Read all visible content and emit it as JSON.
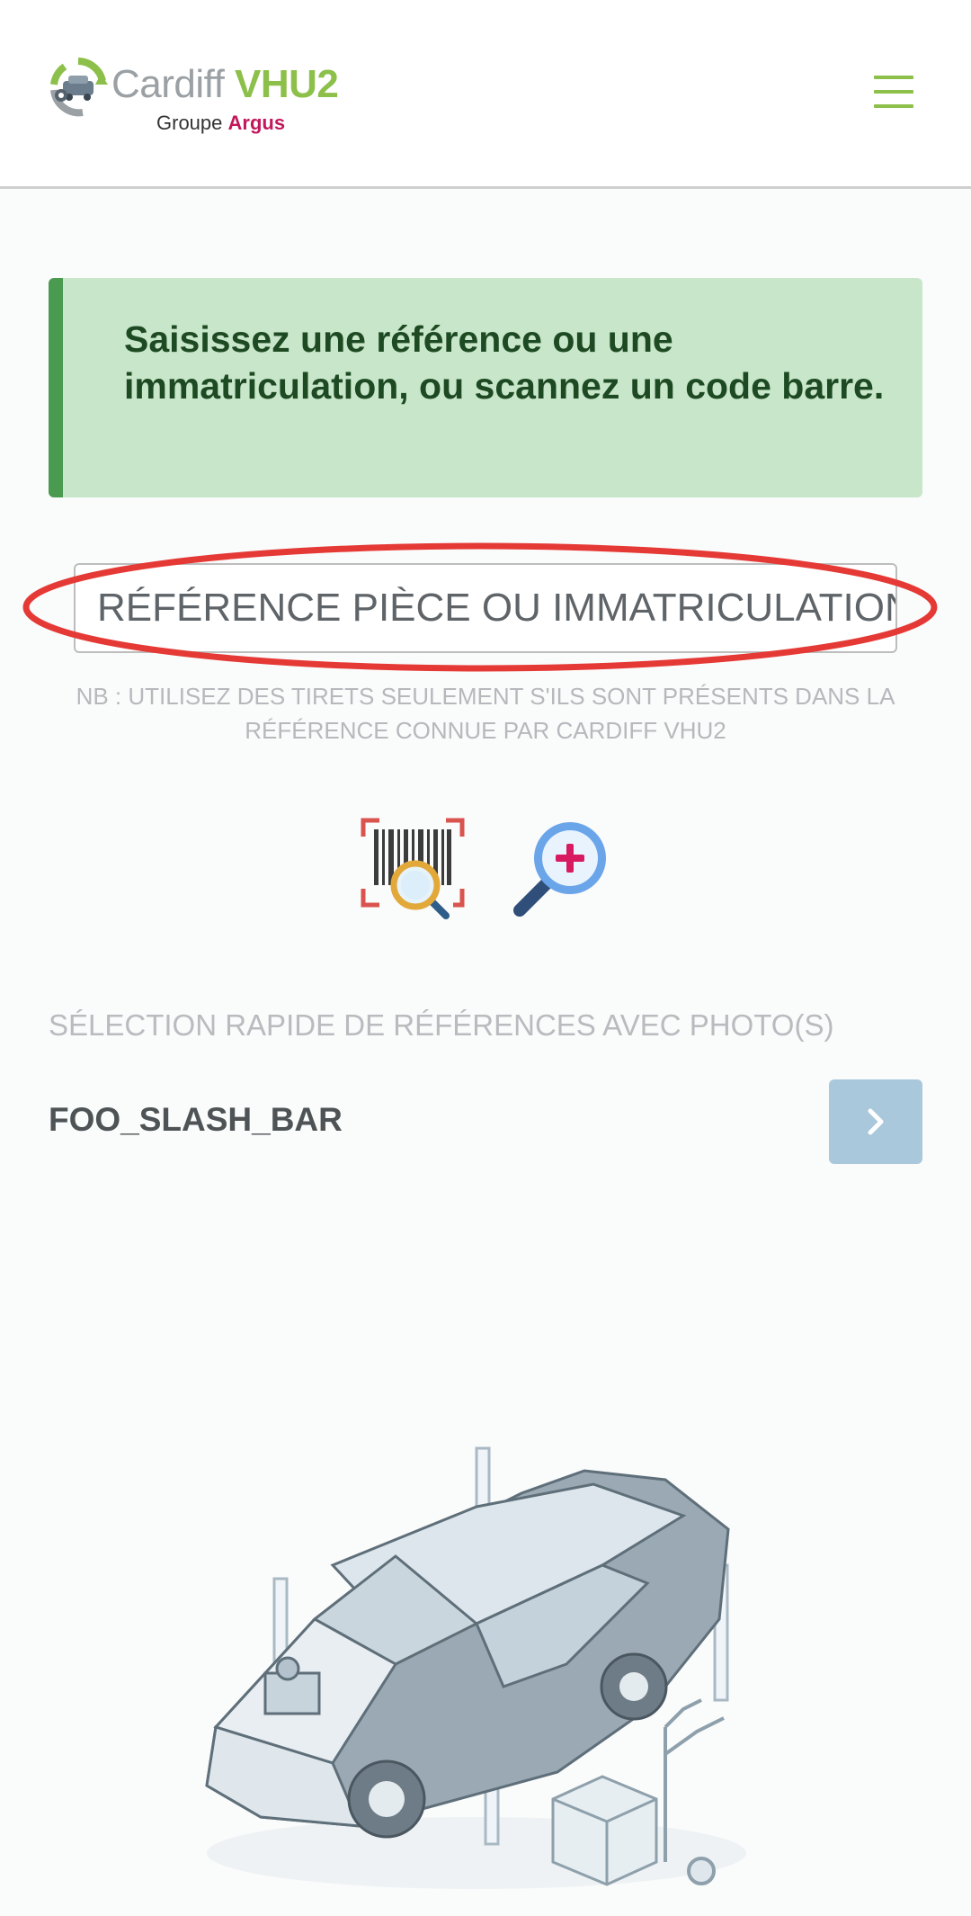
{
  "header": {
    "brand_name": "Cardiff ",
    "brand_accent": "VHU2",
    "brand_sub": "Groupe ",
    "brand_sub_accent": "Argus",
    "menu_icon": "hamburger-menu-icon"
  },
  "banner": {
    "text": "Saisissez une référence ou une immatriculation, ou scannez un code barre."
  },
  "search": {
    "placeholder": "RÉFÉRENCE PIÈCE OU IMMATRICULATION",
    "value": "",
    "note": "NB : UTILISEZ DES TIRETS SEULEMENT S'ILS SONT PRÉSENTS DANS LA RÉFÉRENCE CONNUE PAR CARDIFF VHU2"
  },
  "actions": {
    "scan_icon": "barcode-scan-icon",
    "zoom_icon": "zoom-search-icon"
  },
  "quick_select": {
    "title": "SÉLECTION RAPIDE DE RÉFÉRENCES AVEC PHOTO(S)",
    "items": [
      {
        "label": "FOO_SLASH_BAR",
        "button_icon": "chevron-right-icon"
      }
    ]
  },
  "colors": {
    "brand_green": "#8cc04a",
    "brand_magenta": "#c2185b",
    "banner_bg": "#c8e6c9",
    "banner_border": "#4a9a50",
    "highlight_red": "#e53935",
    "quick_button": "#a9c8db"
  }
}
